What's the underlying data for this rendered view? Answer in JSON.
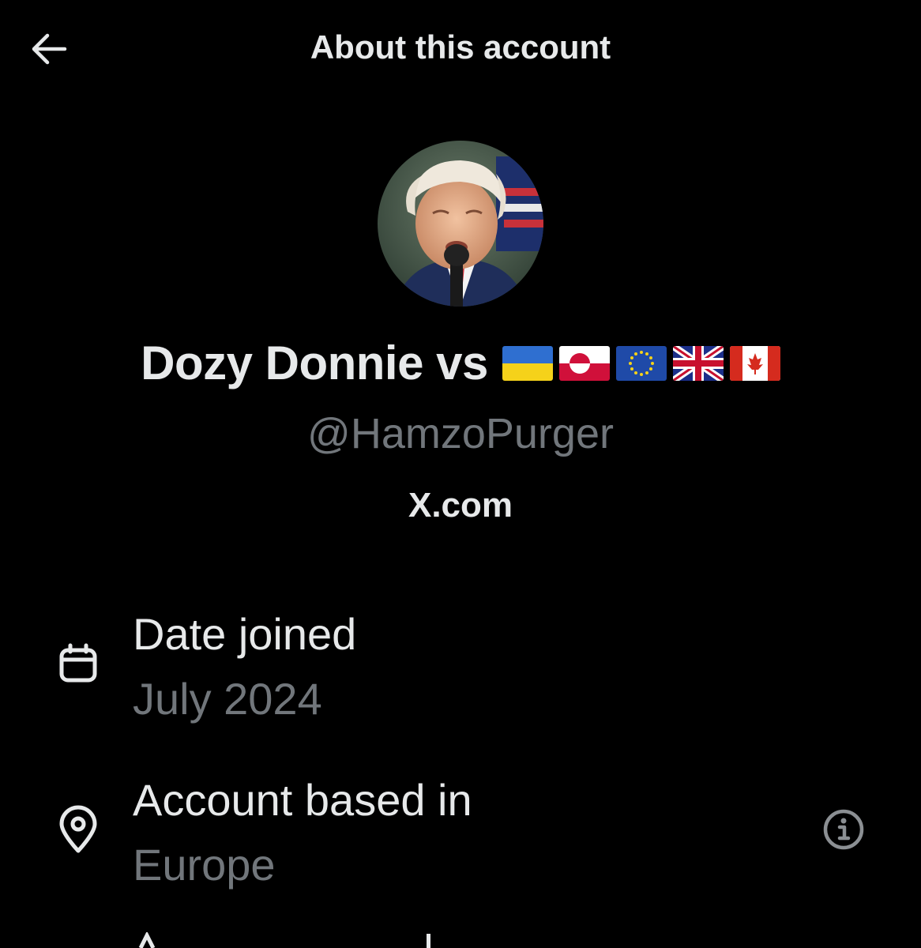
{
  "header": {
    "title": "About this account",
    "back_icon": "arrow-left-icon"
  },
  "profile": {
    "avatar_icon": "profile-photo",
    "display_name": "Dozy Donnie vs",
    "flags": [
      "flag-ukraine",
      "flag-greenland",
      "flag-eu",
      "flag-uk",
      "flag-canada"
    ],
    "handle": "@HamzoPurger",
    "source": "X.com"
  },
  "details": [
    {
      "icon": "calendar-icon",
      "label": "Date joined",
      "value": "July 2024"
    },
    {
      "icon": "location-pin-icon",
      "label": "Account based in",
      "value": "Europe",
      "info_icon": "info-icon"
    }
  ],
  "colors": {
    "background": "#000000",
    "primary_text": "#e7e9ea",
    "secondary_text": "#71767b"
  }
}
